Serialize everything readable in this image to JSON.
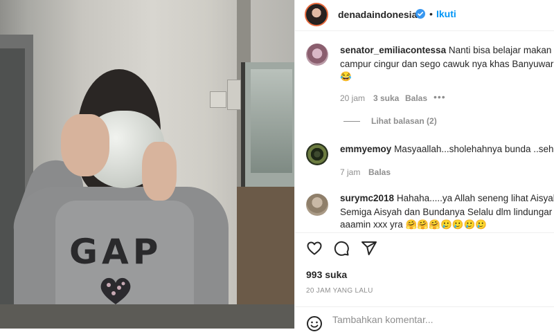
{
  "post": {
    "username": "denadaindonesia",
    "dot": "•",
    "follow_label": "Ikuti",
    "photo_logo": "GAP"
  },
  "comments": [
    {
      "username": "senator_emiliacontessa",
      "text_line1": "Nanti bisa belajar makan r",
      "text_line2": "campur cingur dan sego cawuk nya khas Banyuwar",
      "text_line3": "😂",
      "time": "20 jam",
      "likes": "3 suka",
      "reply": "Balas",
      "more": "•••",
      "view_replies": "Lihat balasan (2)"
    },
    {
      "username": "emmyemoy",
      "text_line1": "Masyaallah...sholehahnya bunda ..seha",
      "time": "7 jam",
      "reply": "Balas"
    },
    {
      "username": "surymc2018",
      "text_line1": "Hahaha.....ya Allah seneng lihat Aisyah",
      "text_line2": "Semiga Aisyah dan Bundanya Selalu dlm lindungar",
      "text_line3": "aaamin xxx yra 🤗🤗🤗🥲🥲🥲🥲"
    }
  ],
  "actions": {
    "likes": "993 suka",
    "time_ago": "20 JAM YANG LALU"
  },
  "add_comment": {
    "placeholder": "Tambahkan komentar..."
  },
  "icons": {
    "verified": "verified-badge-icon",
    "like": "heart-icon",
    "comment": "comment-icon",
    "share": "share-icon",
    "emoji": "emoji-icon"
  },
  "colors": {
    "link_blue": "#0095f6",
    "verified_blue": "#3897f0",
    "text": "#262626",
    "muted": "#8e8e8e"
  }
}
